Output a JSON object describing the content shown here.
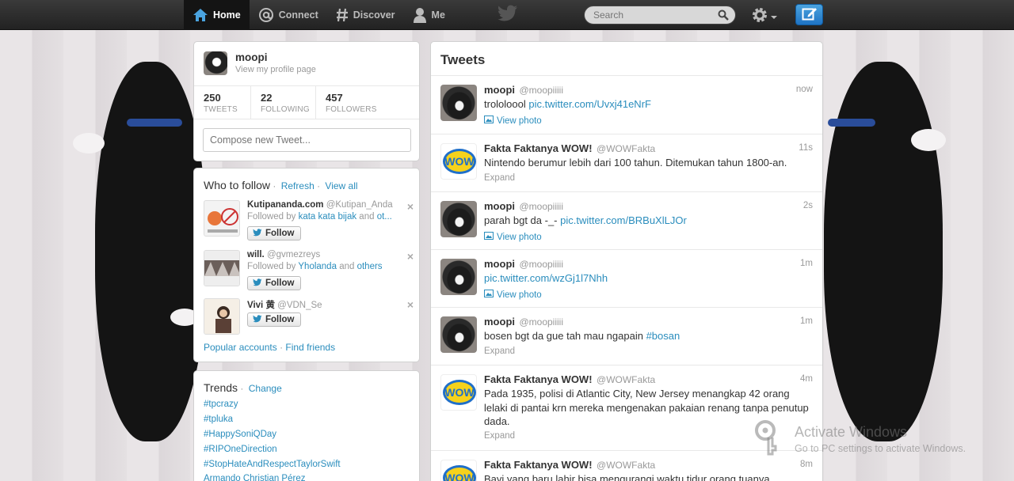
{
  "nav": {
    "home": "Home",
    "connect": "Connect",
    "discover": "Discover",
    "me": "Me"
  },
  "search": {
    "placeholder": "Search"
  },
  "profile": {
    "name": "moopi",
    "link": "View my profile page",
    "stats": [
      {
        "num": "250",
        "label": "TWEETS"
      },
      {
        "num": "22",
        "label": "FOLLOWING"
      },
      {
        "num": "457",
        "label": "FOLLOWERS"
      }
    ],
    "compose_placeholder": "Compose new Tweet..."
  },
  "who_to_follow": {
    "title": "Who to follow",
    "refresh": "Refresh",
    "view_all": "View all",
    "items": [
      {
        "name": "Kutipananda.com",
        "screen": "@Kutipan_Anda",
        "by_prefix": "Followed by",
        "by_link": "kata kata bijak",
        "by_and": "and",
        "by_more": "ot...",
        "follow": "Follow"
      },
      {
        "name": "will.",
        "screen": "@gvmezreys",
        "by_prefix": "Followed by",
        "by_link": "Yholanda",
        "by_and": "and",
        "by_more": "others",
        "follow": "Follow"
      },
      {
        "name": "Vivi 黄",
        "screen": "@VDN_Se",
        "by_prefix": "",
        "by_link": "",
        "by_and": "",
        "by_more": "",
        "follow": "Follow"
      }
    ],
    "popular": "Popular accounts",
    "find": "Find friends"
  },
  "trends": {
    "title": "Trends",
    "change": "Change",
    "items": [
      "#tpcrazy",
      "#tpluka",
      "#HappySoniQDay",
      "#RIPOneDirection",
      "#StopHateAndRespectTaylorSwift",
      "Armando Christian Pérez"
    ]
  },
  "tweets": {
    "title": "Tweets",
    "items": [
      {
        "name": "moopi",
        "screen": "@moopiiiii",
        "time": "now",
        "text": "trololoool ",
        "link": "pic.twitter.com/Uvxj41eNrF",
        "action": "View photo"
      },
      {
        "name": "Fakta Faktanya WOW!",
        "screen": "@WOWFakta",
        "time": "11s",
        "text": "Nintendo berumur lebih dari 100 tahun. Ditemukan tahun 1800-an.",
        "link": "",
        "action": "Expand"
      },
      {
        "name": "moopi",
        "screen": "@moopiiiii",
        "time": "2s",
        "text": "parah bgt da -_- ",
        "link": "pic.twitter.com/BRBuXlLJOr",
        "action": "View photo"
      },
      {
        "name": "moopi",
        "screen": "@moopiiiii",
        "time": "1m",
        "text": "",
        "link": "pic.twitter.com/wzGj1l7Nhh",
        "action": "View photo"
      },
      {
        "name": "moopi",
        "screen": "@moopiiiii",
        "time": "1m",
        "text": "bosen bgt da gue tah mau ngapain ",
        "link": "#bosan",
        "action": "Expand"
      },
      {
        "name": "Fakta Faktanya WOW!",
        "screen": "@WOWFakta",
        "time": "4m",
        "text": "Pada 1935, polisi di Atlantic City, New Jersey menangkap 42 orang lelaki di pantai krn mereka mengenakan pakaian renang tanpa penutup dada.",
        "link": "",
        "action": "Expand"
      },
      {
        "name": "Fakta Faktanya WOW!",
        "screen": "@WOWFakta",
        "time": "8m",
        "text": "Bayi yang baru lahir bisa mengurangi waktu tidur orang tuanya",
        "link": "",
        "action": ""
      }
    ]
  },
  "watermark": {
    "title": "Activate Windows",
    "sub": "Go to PC settings to activate Windows."
  }
}
